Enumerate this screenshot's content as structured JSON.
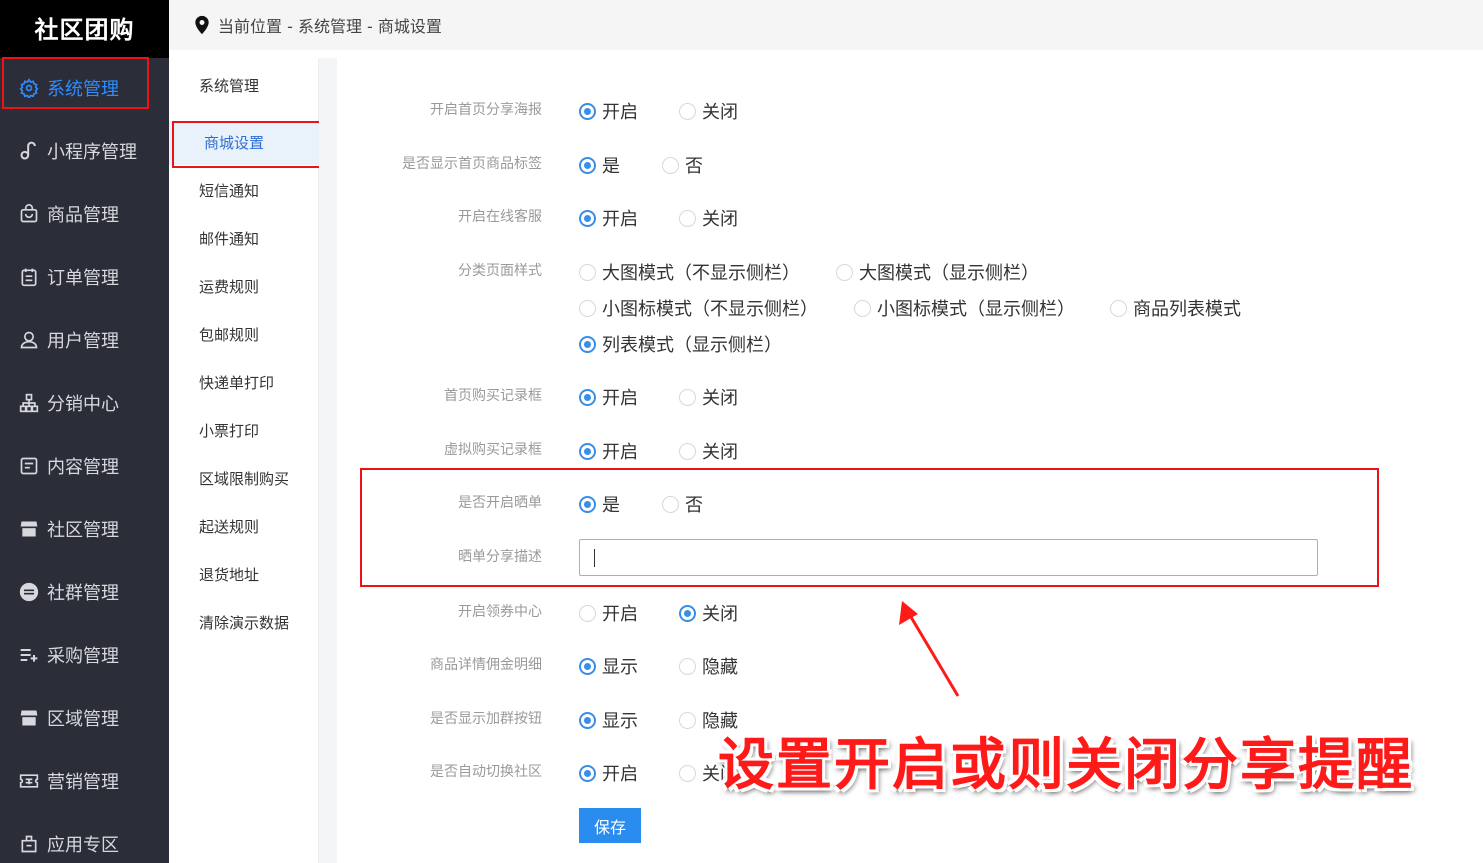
{
  "brand": "社区团购",
  "breadcrumb": "当前位置 - 系统管理 - 商城设置",
  "sidebar": {
    "items": [
      {
        "label": "系统管理",
        "icon": "gear-icon"
      },
      {
        "label": "小程序管理",
        "icon": "link-icon"
      },
      {
        "label": "商品管理",
        "icon": "bag-icon"
      },
      {
        "label": "订单管理",
        "icon": "clipboard-icon"
      },
      {
        "label": "用户管理",
        "icon": "user-icon"
      },
      {
        "label": "分销中心",
        "icon": "hierarchy-icon"
      },
      {
        "label": "内容管理",
        "icon": "document-icon"
      },
      {
        "label": "社区管理",
        "icon": "store-icon"
      },
      {
        "label": "社群管理",
        "icon": "group-icon"
      },
      {
        "label": "采购管理",
        "icon": "list-add-icon"
      },
      {
        "label": "区域管理",
        "icon": "store-icon"
      },
      {
        "label": "营销管理",
        "icon": "ticket-icon"
      },
      {
        "label": "应用专区",
        "icon": "apps-icon"
      }
    ],
    "active": "系统管理"
  },
  "submenu": {
    "items": [
      "系统管理",
      "商城设置",
      "短信通知",
      "邮件通知",
      "运费规则",
      "包邮规则",
      "快递单打印",
      "小票打印",
      "区域限制购买",
      "起送规则",
      "退货地址",
      "清除演示数据"
    ],
    "active": "商城设置"
  },
  "form": {
    "share_poster": {
      "label": "开启首页分享海报",
      "options": [
        "开启",
        "关闭"
      ],
      "selected": "开启"
    },
    "show_tags": {
      "label": "是否显示首页商品标签",
      "options": [
        "是",
        "否"
      ],
      "selected": "是"
    },
    "online_service": {
      "label": "开启在线客服",
      "options": [
        "开启",
        "关闭"
      ],
      "selected": "开启"
    },
    "category_style": {
      "label": "分类页面样式",
      "options": [
        "大图模式（不显示侧栏）",
        "大图模式（显示侧栏）",
        "小图标模式（不显示侧栏）",
        "小图标模式（显示侧栏）",
        "商品列表模式",
        "列表模式（显示侧栏）"
      ],
      "selected": "列表模式（显示侧栏）"
    },
    "purchase_record": {
      "label": "首页购买记录框",
      "options": [
        "开启",
        "关闭"
      ],
      "selected": "开启"
    },
    "virtual_record": {
      "label": "虚拟购买记录框",
      "options": [
        "开启",
        "关闭"
      ],
      "selected": "开启"
    },
    "enable_showoff": {
      "label": "是否开启晒单",
      "options": [
        "是",
        "否"
      ],
      "selected": "是"
    },
    "showoff_desc": {
      "label": "晒单分享描述",
      "value": "",
      "placeholder": ""
    },
    "coupon_center": {
      "label": "开启领券中心",
      "options": [
        "开启",
        "关闭"
      ],
      "selected": "关闭"
    },
    "commission_detail": {
      "label": "商品详情佣金明细",
      "options": [
        "显示",
        "隐藏"
      ],
      "selected": "显示"
    },
    "join_group_btn": {
      "label": "是否显示加群按钮",
      "options": [
        "显示",
        "隐藏"
      ],
      "selected": "显示"
    },
    "auto_switch": {
      "label": "是否自动切换社区",
      "options": [
        "开启",
        "关闭"
      ],
      "selected": "开启"
    },
    "save_label": "保存"
  },
  "annotation": "设置开启或则关闭分享提醒",
  "colors": {
    "accent": "#3a8ee6",
    "annotation": "#ff1a1a",
    "sidebar_bg": "#2b2e38"
  }
}
